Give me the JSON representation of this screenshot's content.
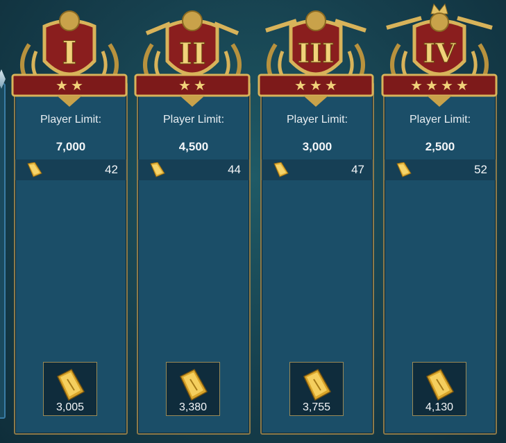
{
  "tiers": [
    {
      "numeral": "I",
      "stars": 2,
      "label": "Player Limit:",
      "limit": "7,000",
      "reward": "42",
      "prize": "3,005"
    },
    {
      "numeral": "II",
      "stars": 2,
      "label": "Player Limit:",
      "limit": "4,500",
      "reward": "44",
      "prize": "3,380"
    },
    {
      "numeral": "III",
      "stars": 3,
      "label": "Player Limit:",
      "limit": "3,000",
      "reward": "47",
      "prize": "3,755"
    },
    {
      "numeral": "IV",
      "stars": 4,
      "label": "Player Limit:",
      "limit": "2,500",
      "reward": "52",
      "prize": "4,130"
    }
  ],
  "colors": {
    "card": "#1b4e68",
    "gold": "#d8b35a",
    "crimson": "#8a1e1e"
  },
  "icons": {
    "badge": "lion-crest-icon",
    "reward": "gold-bar-icon"
  }
}
